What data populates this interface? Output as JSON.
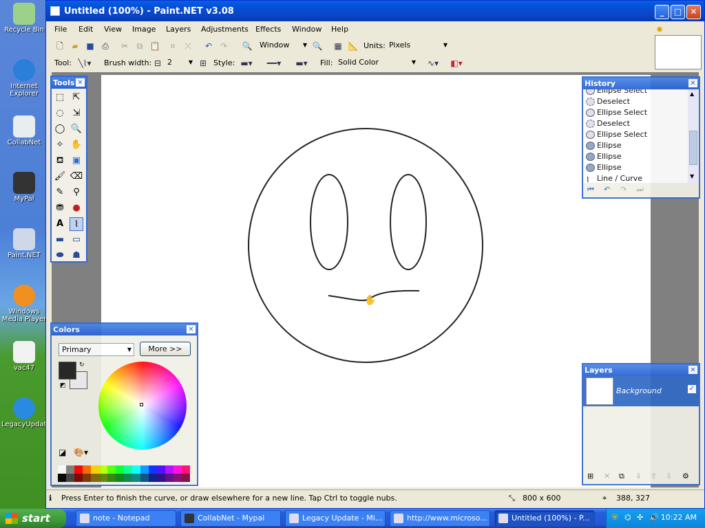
{
  "desktop": {
    "icons": [
      {
        "label": "Recycle Bin"
      },
      {
        "label": "Internet Explorer"
      },
      {
        "label": "CollabNet"
      },
      {
        "label": "MyPal"
      },
      {
        "label": "Paint.NET"
      },
      {
        "label": "Windows Media Player"
      },
      {
        "label": "vac47"
      },
      {
        "label": "LegacyUpdate"
      }
    ]
  },
  "window": {
    "title": "Untitled (100%) - Paint.NET v3.08",
    "menu": [
      "File",
      "Edit",
      "View",
      "Image",
      "Layers",
      "Adjustments",
      "Effects",
      "Window",
      "Help"
    ]
  },
  "toolbar": {
    "zoom_value": "Window",
    "units_label": "Units:",
    "units_value": "Pixels",
    "tool_label": "Tool:",
    "brush_width_label": "Brush width:",
    "brush_width_value": "2",
    "style_label": "Style:",
    "fill_label": "Fill:",
    "fill_value": "Solid Color"
  },
  "tools_panel": {
    "title": "Tools"
  },
  "colors_panel": {
    "title": "Colors",
    "mode_value": "Primary",
    "more_button": "More >>",
    "primary_color": "#222222",
    "secondary_color": "#f0f0f0",
    "palette": [
      "#000000",
      "#404040",
      "#7f0000",
      "#7f3300",
      "#7f6a00",
      "#5b7f00",
      "#267f00",
      "#007f0e",
      "#007f46",
      "#007f7f",
      "#004a7f",
      "#00137f",
      "#21007f",
      "#57007f",
      "#7f006e",
      "#7f0037"
    ],
    "palette2": [
      "#ffffff",
      "#808080",
      "#ff0000",
      "#ff6a00",
      "#ffd800",
      "#b6ff00",
      "#4cff00",
      "#00ff21",
      "#00ff90",
      "#00ffff",
      "#0094ff",
      "#0026ff",
      "#4800ff",
      "#b200ff",
      "#ff00dc",
      "#ff006e"
    ]
  },
  "history_panel": {
    "title": "History",
    "items": [
      {
        "label": "Ellipse Select",
        "icon": "ellipse-select-icon"
      },
      {
        "label": "Deselect",
        "icon": "deselect-icon"
      },
      {
        "label": "Ellipse Select",
        "icon": "ellipse-select-icon"
      },
      {
        "label": "Deselect",
        "icon": "deselect-icon"
      },
      {
        "label": "Ellipse Select",
        "icon": "ellipse-select-icon"
      },
      {
        "label": "Ellipse",
        "icon": "ellipse-icon"
      },
      {
        "label": "Ellipse",
        "icon": "ellipse-icon"
      },
      {
        "label": "Ellipse",
        "icon": "ellipse-icon"
      },
      {
        "label": "Line / Curve",
        "icon": "line-curve-icon"
      }
    ]
  },
  "layers_panel": {
    "title": "Layers",
    "layers": [
      {
        "name": "Background",
        "visible": true
      }
    ]
  },
  "status": {
    "hint": "Press Enter to finish the curve, or draw elsewhere for a new line. Tap Ctrl to toggle nubs.",
    "image_size": "800 x 600",
    "cursor_pos": "388, 327"
  },
  "taskbar": {
    "start": "start",
    "tasks": [
      {
        "label": "note - Notepad"
      },
      {
        "label": "CollabNet - Mypal"
      },
      {
        "label": "Legacy Update - Mi..."
      },
      {
        "label": "http://www.microso..."
      },
      {
        "label": "Untitled (100%) - P..."
      }
    ],
    "clock": "10:22 AM"
  }
}
